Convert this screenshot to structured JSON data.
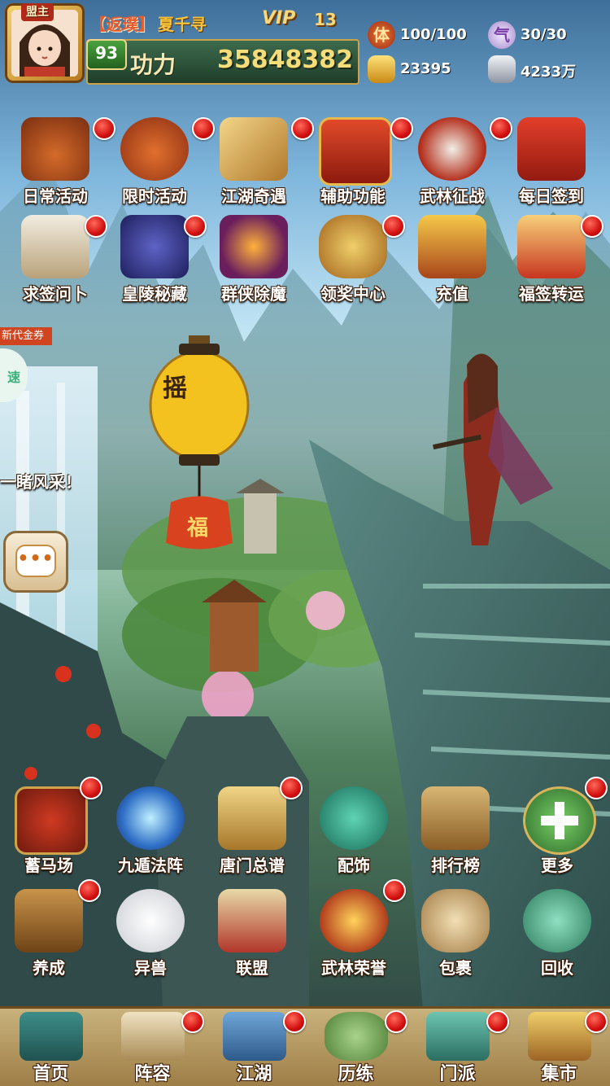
{
  "player": {
    "alliance_title": "盟主",
    "name_tag": "【返璞】",
    "name": "夏千寻",
    "vip_label": "VIP",
    "vip_level": "13",
    "level": "93",
    "power_label": "功力",
    "power_value": "35848382"
  },
  "resources": {
    "stamina": {
      "icon": "stamina-icon",
      "glyph": "体",
      "value": "100/100"
    },
    "energy": {
      "icon": "qi-icon",
      "glyph": "气",
      "value": "30/30"
    },
    "gold": {
      "icon": "gold-ingot-icon",
      "value": "23395"
    },
    "silver": {
      "icon": "silver-ingot-icon",
      "value": "4233万"
    }
  },
  "top_menu_row1": [
    {
      "label": "日常活动",
      "icon": "daily-activity-icon",
      "dot": true
    },
    {
      "label": "限时活动",
      "icon": "limited-activity-icon",
      "dot": true
    },
    {
      "label": "江湖奇遇",
      "icon": "adventure-scroll-icon",
      "dot": true
    },
    {
      "label": "辅助功能",
      "icon": "helper-chest-icon",
      "dot": true
    },
    {
      "label": "武林征战",
      "icon": "crossed-swords-icon",
      "dot": true
    },
    {
      "label": "每日签到",
      "icon": "sign-in-scroll-icon",
      "dot": false
    }
  ],
  "top_menu_row2": [
    {
      "label": "求签问卜",
      "icon": "fortune-sage-icon",
      "dot": true
    },
    {
      "label": "皇陵秘藏",
      "icon": "tomb-dragon-icon",
      "dot": true
    },
    {
      "label": "群侠除魔",
      "icon": "demon-gate-icon",
      "dot": false
    },
    {
      "label": "领奖中心",
      "icon": "reward-bag-icon",
      "dot": true
    },
    {
      "label": "充值",
      "icon": "treasure-chest-icon",
      "dot": false
    },
    {
      "label": "福签转运",
      "icon": "lucky-sticks-icon",
      "dot": true
    }
  ],
  "side": {
    "coupon_label": "新代金券",
    "speed_label": "速",
    "notice_text": "一睹风采！"
  },
  "lantern": {
    "text": "摇",
    "charm_text": "福"
  },
  "bottom_menu_row1": [
    {
      "label": "蓄马场",
      "icon": "drum-icon",
      "dot": true
    },
    {
      "label": "九遁法阵",
      "icon": "magic-array-icon",
      "dot": false
    },
    {
      "label": "唐门总谱",
      "icon": "manual-book-icon",
      "dot": true
    },
    {
      "label": "配饰",
      "icon": "jade-pendant-icon",
      "dot": false
    },
    {
      "label": "排行榜",
      "icon": "ranking-board-icon",
      "dot": false
    },
    {
      "label": "更多",
      "icon": "plus-icon",
      "dot": true
    }
  ],
  "bottom_menu_row2": [
    {
      "label": "养成",
      "icon": "weapon-crate-icon",
      "dot": true
    },
    {
      "label": "异兽",
      "icon": "beast-icon",
      "dot": false
    },
    {
      "label": "联盟",
      "icon": "alliance-banner-icon",
      "dot": false
    },
    {
      "label": "武林荣誉",
      "icon": "honor-medal-icon",
      "dot": true
    },
    {
      "label": "包裹",
      "icon": "bag-icon",
      "dot": false
    },
    {
      "label": "回收",
      "icon": "recycle-jade-icon",
      "dot": false
    }
  ],
  "nav": [
    {
      "label": "首页",
      "icon": "home-icon",
      "dot": false
    },
    {
      "label": "阵容",
      "icon": "lineup-icon",
      "dot": true
    },
    {
      "label": "江湖",
      "icon": "jianghu-icon",
      "dot": true
    },
    {
      "label": "历练",
      "icon": "training-icon",
      "dot": true
    },
    {
      "label": "门派",
      "icon": "sect-icon",
      "dot": true
    },
    {
      "label": "集市",
      "icon": "market-icon",
      "dot": true
    }
  ],
  "colors": {
    "badge_red": "#d20f0f",
    "gold_text": "#f7dd7a",
    "power_bar": "#2c5236"
  }
}
